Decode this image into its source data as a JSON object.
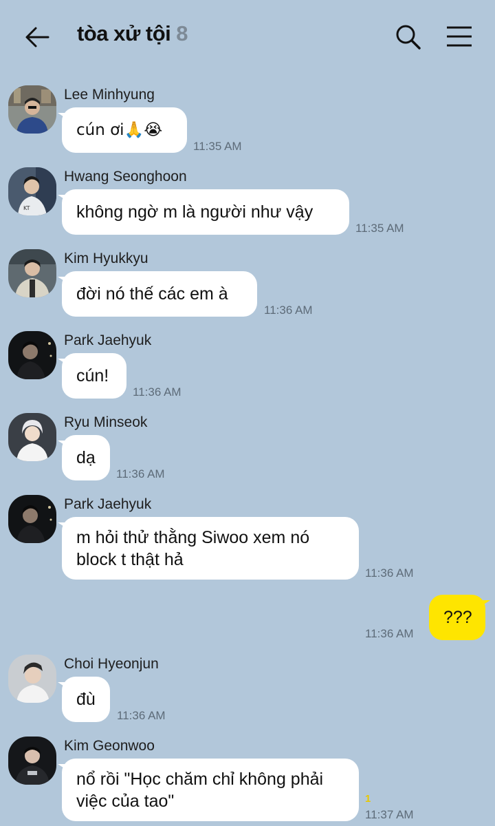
{
  "header": {
    "title": "tòa xử tội",
    "member_count": "8",
    "back_icon": "back-arrow-icon",
    "search_icon": "search-icon",
    "menu_icon": "menu-icon"
  },
  "messages": [
    {
      "sender": "Lee Minhyung",
      "text": "cún ơi🙏😭",
      "time": "11:35 AM"
    },
    {
      "sender": "Hwang Seonghoon",
      "text": "không ngờ m là người như vậy",
      "time": "11:35 AM"
    },
    {
      "sender": "Kim Hyukkyu",
      "text": "đời nó thế các em à",
      "time": "11:36 AM"
    },
    {
      "sender": "Park Jaehyuk",
      "text": "cún!",
      "time": "11:36 AM"
    },
    {
      "sender": "Ryu Minseok",
      "text": "dạ",
      "time": "11:36 AM"
    },
    {
      "sender": "Park Jaehyuk",
      "text": "m  hỏi thử thằng Siwoo xem nó block t thật hả",
      "time": "11:36 AM"
    },
    {
      "sender": "me",
      "text": "???",
      "time": "11:36 AM"
    },
    {
      "sender": "Choi Hyeonjun",
      "text": "đù",
      "time": "11:36 AM"
    },
    {
      "sender": "Kim Geonwoo",
      "text": "nổ rồi \"Học chăm chỉ không phải việc của tao\"",
      "time": "11:37 AM",
      "unread": "1"
    }
  ],
  "colors": {
    "background": "#b2c7da",
    "incoming_bubble": "#ffffff",
    "outgoing_bubble": "#fee500",
    "unread_count": "#e8c800"
  }
}
